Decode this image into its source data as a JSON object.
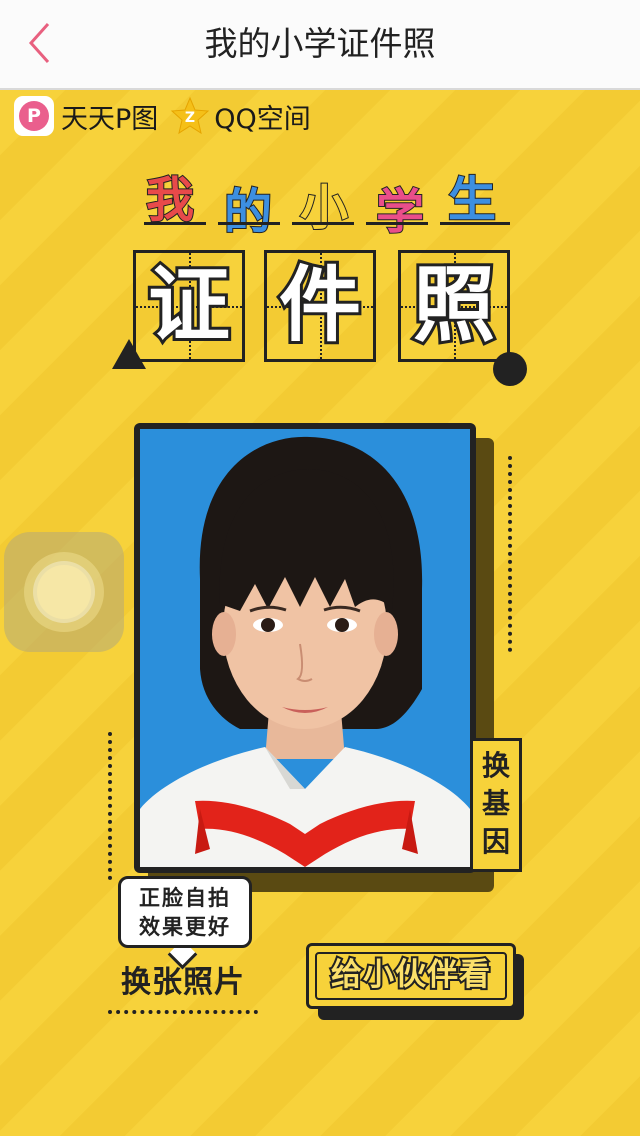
{
  "navbar": {
    "title": "我的小学证件照",
    "back_icon": "chevron-left-icon"
  },
  "brand": {
    "pitu_logo_letter": "P",
    "pitu_name": "天天P图",
    "qzone_name": "QQ空间"
  },
  "heading": {
    "line1": [
      {
        "char": "我",
        "color": "#e84a4a"
      },
      {
        "char": "的",
        "color": "#3d8fe0"
      },
      {
        "char": "小",
        "color": "#f7d23a"
      },
      {
        "char": "学",
        "color": "#e94e8a"
      },
      {
        "char": "生",
        "color": "#3d8fe0"
      }
    ],
    "line2": [
      "证",
      "件",
      "照"
    ]
  },
  "photo": {
    "background": "#2b8fdb",
    "subject": "girl-with-bangs-red-scarf"
  },
  "buttons": {
    "change_gene": [
      "换",
      "基",
      "因"
    ],
    "change_photo": "换张照片",
    "share": "给小伙伴看"
  },
  "tip": {
    "line1": "正脸自拍",
    "line2": "效果更好"
  },
  "colors": {
    "background": "#f7d23a",
    "ink": "#222222",
    "pitu": "#ea5f8d"
  }
}
